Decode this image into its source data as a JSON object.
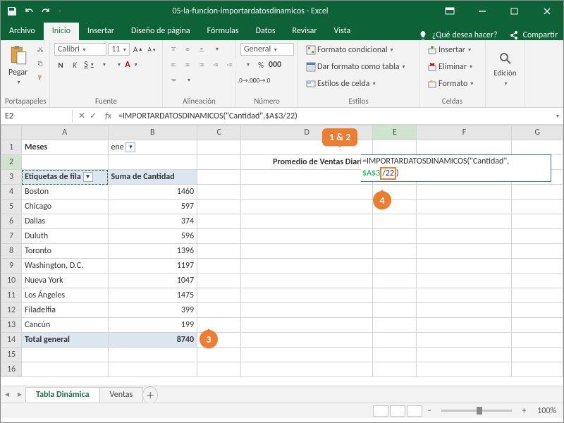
{
  "title": "05-la-funcion-importardatosdinamicos - Excel",
  "qat": {
    "save": "Guardar",
    "undo": "Deshacer",
    "redo": "Rehacer"
  },
  "tabs": [
    "Archivo",
    "Inicio",
    "Insertar",
    "Diseño de página",
    "Fórmulas",
    "Datos",
    "Revisar",
    "Vista"
  ],
  "active_tab": "Inicio",
  "tell_me": "¿Qué desea hacer?",
  "share": "Compartir",
  "ribbon": {
    "portapapeles": {
      "label": "Portapapeles",
      "paste": "Pegar"
    },
    "fuente": {
      "label": "Fuente",
      "font": "Calibri",
      "size": "11",
      "bold": "N",
      "italic": "K",
      "underline": "S"
    },
    "alineacion": {
      "label": "Alineación"
    },
    "numero": {
      "label": "Número",
      "format": "General"
    },
    "estilos": {
      "label": "Estilos",
      "cond": "Formato condicional",
      "table": "Dar formato como tabla",
      "cell": "Estilos de celda"
    },
    "celdas": {
      "label": "Celdas",
      "insert": "Insertar",
      "delete": "Eliminar",
      "format": "Formato"
    },
    "edicion": {
      "label": "Edición"
    }
  },
  "namebox": "E2",
  "formula": "=IMPORTARDATOSDINAMICOS(\"Cantidad\",$A$3/22)",
  "cols": [
    "A",
    "B",
    "C",
    "D",
    "E",
    "F",
    "G"
  ],
  "rows": [
    "1",
    "2",
    "3",
    "4",
    "5",
    "6",
    "7",
    "8",
    "9",
    "10",
    "11",
    "12",
    "13",
    "14",
    "15",
    "16"
  ],
  "grid": {
    "A1": "Meses",
    "B1": "ene",
    "A3": "Etiquetas de fila",
    "B3": "Suma de Cantidad",
    "D2": "Promedio de Ventas Diarias",
    "E2_over_line1": "=IMPORTARDATOSDINAMICOS(\"Cantidad\",",
    "E2_over_line2a": "$A$3",
    "E2_over_line2b": "/22",
    "E2_over_line2c": ")",
    "A4": "Boston",
    "B4": "1460",
    "A5": "Chicago",
    "B5": "597",
    "A6": "Dallas",
    "B6": "374",
    "A7": "Duluth",
    "B7": "596",
    "A8": "Toronto",
    "B8": "1396",
    "A9": "Washington, D.C.",
    "B9": "1197",
    "A10": "Nueva York",
    "B10": "1047",
    "A11": "Los Ángeles",
    "B11": "1475",
    "A12": "Filadelfia",
    "B12": "399",
    "A13": "Cancún",
    "B13": "199",
    "A14": "Total general",
    "B14": "8740"
  },
  "callouts": {
    "c12": "1 & 2",
    "c3": "3",
    "c4": "4"
  },
  "sheet_tabs": [
    "Tabla Dinámica",
    "Ventas"
  ],
  "active_sheet": "Tabla Dinámica",
  "status": {
    "zoom": "100%"
  }
}
